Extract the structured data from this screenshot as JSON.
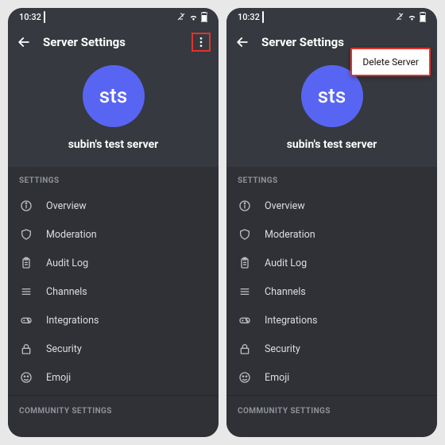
{
  "status": {
    "time": "10:32"
  },
  "header": {
    "title": "Server Settings"
  },
  "popup": {
    "delete_label": "Delete Server"
  },
  "server": {
    "initials": "sts",
    "name": "subin's test server"
  },
  "sections": {
    "settings_label": "SETTINGS",
    "community_label": "COMMUNITY SETTINGS",
    "items": [
      {
        "label": "Overview"
      },
      {
        "label": "Moderation"
      },
      {
        "label": "Audit Log"
      },
      {
        "label": "Channels"
      },
      {
        "label": "Integrations"
      },
      {
        "label": "Security"
      },
      {
        "label": "Emoji"
      }
    ]
  }
}
